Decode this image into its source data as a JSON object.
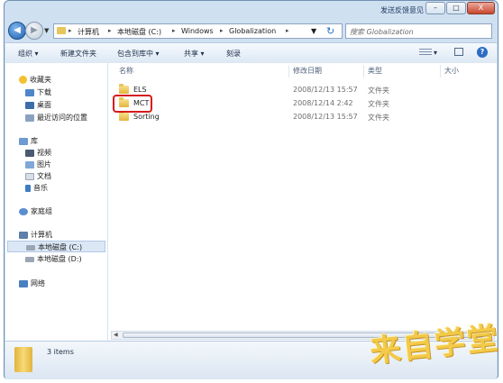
{
  "window": {
    "feedback_link": "发送反馈意见",
    "minimize_glyph": "–",
    "maximize_glyph": "□",
    "close_glyph": "X"
  },
  "navigation": {
    "back_glyph": "◀",
    "forward_glyph": "▶",
    "history_glyph": "▼",
    "breadcrumb": [
      "计算机",
      "本地磁盘 (C:)",
      "Windows",
      "Globalization"
    ],
    "separator_glyph": "▸",
    "refresh_glyph": "↻",
    "search_placeholder": "搜索 Globalization"
  },
  "toolbar": {
    "organize": "组织",
    "new_folder": "新建文件夹",
    "include_in_library": "包含到库中",
    "share": "共享",
    "burn": "刻录",
    "dropdown_glyph": "▾",
    "help_glyph": "?"
  },
  "sidebar": {
    "favorites_header": "收藏夹",
    "favorites": [
      "下载",
      "桌面",
      "最近访问的位置"
    ],
    "libraries_header": "库",
    "libraries": [
      "视频",
      "图片",
      "文档",
      "音乐"
    ],
    "homegroup": "家庭组",
    "computer_header": "计算机",
    "drives": [
      "本地磁盘 (C:)",
      "本地磁盘 (D:)"
    ],
    "selected_drive": "本地磁盘 (C:)",
    "network": "网络"
  },
  "file_list": {
    "columns": [
      "名称",
      "修改日期",
      "类型",
      "大小"
    ],
    "rows": [
      {
        "name": "ELS",
        "modified": "2008/12/13 15:57",
        "type": "文件夹"
      },
      {
        "name": "MCT",
        "modified": "2008/12/14 2:42",
        "type": "文件夹",
        "highlighted": true
      },
      {
        "name": "Sorting",
        "modified": "2008/12/13 15:57",
        "type": "文件夹"
      }
    ]
  },
  "status": {
    "item_count": "3 items"
  },
  "watermark": "来自学堂",
  "colors": {
    "highlight_border": "#d41c1c",
    "folder": "#e8c55a",
    "selected_nav": "#dbe7f5"
  }
}
